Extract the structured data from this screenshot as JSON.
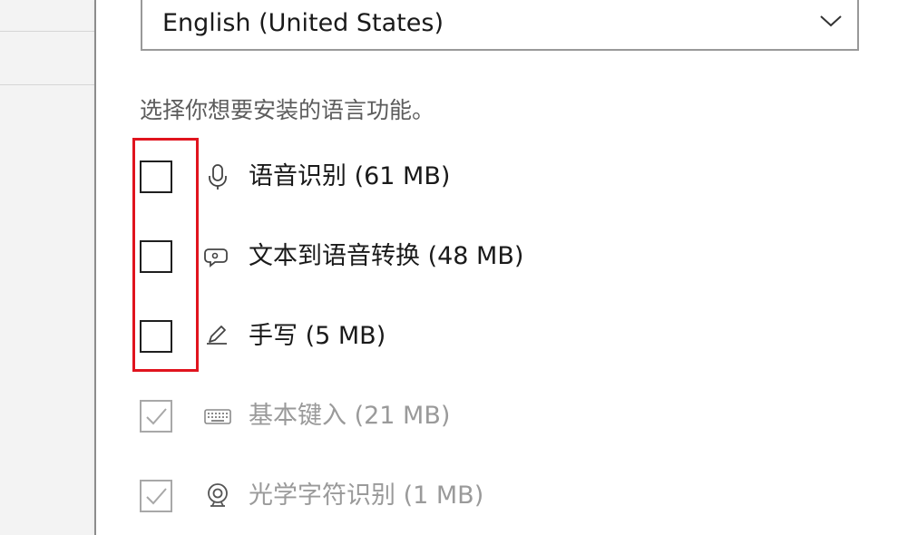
{
  "language_select": {
    "value": "English (United States)"
  },
  "features_prompt": "选择你想要安装的语言功能。",
  "features": [
    {
      "label": "语音识别 (61 MB)",
      "icon": "microphone-icon",
      "checked": false,
      "disabled": false
    },
    {
      "label": "文本到语音转换 (48 MB)",
      "icon": "text-to-speech-icon",
      "checked": false,
      "disabled": false
    },
    {
      "label": "手写 (5 MB)",
      "icon": "handwriting-pen-icon",
      "checked": false,
      "disabled": false
    },
    {
      "label": "基本键入 (21 MB)",
      "icon": "keyboard-icon",
      "checked": true,
      "disabled": true
    },
    {
      "label": "光学字符识别 (1 MB)",
      "icon": "camera-icon",
      "checked": true,
      "disabled": true
    }
  ],
  "colors": {
    "highlight": "#e0141e",
    "disabled_text": "#9a9a9a",
    "text": "#1a1a1a"
  }
}
